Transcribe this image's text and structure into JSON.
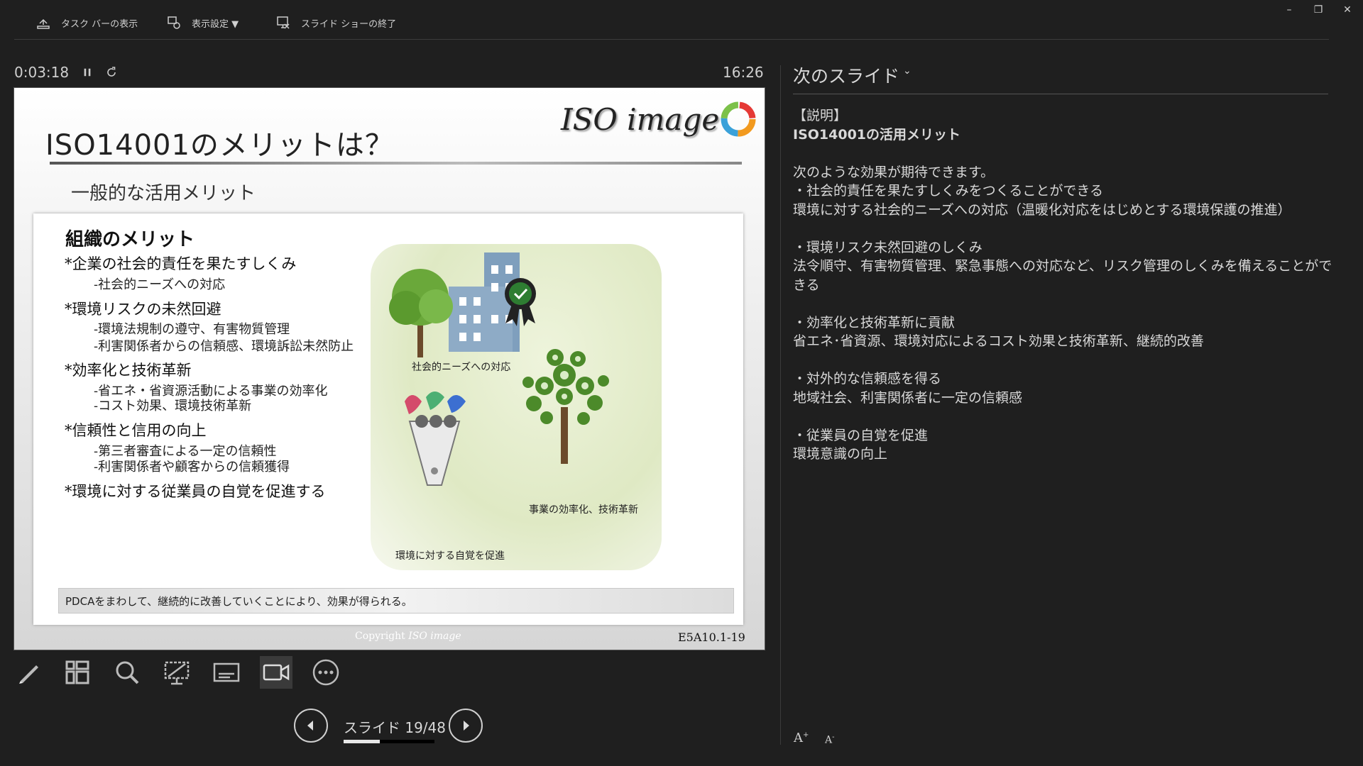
{
  "toolbar": {
    "taskbar_label": "タスク バーの表示",
    "display_label": "表示設定 ▼",
    "end_label": "スライド ショーの終了"
  },
  "window": {
    "minimize": "–",
    "restore": "❐",
    "close": "✕"
  },
  "presenter": {
    "elapsed": "0:03:18",
    "clock": "16:26",
    "pause_icon": "pause-icon",
    "restart_icon": "restart-icon"
  },
  "slide": {
    "title": "ISO14001のメリットは？",
    "subtitle": "一般的な活用メリット",
    "logo_text": "ISO image",
    "section_heading": "組織のメリット",
    "items": [
      {
        "label": "*企業の社会的責任を果たすしくみ",
        "subs": [
          "-社会的ニーズへの対応"
        ]
      },
      {
        "label": "*環境リスクの未然回避",
        "subs": [
          "-環境法規制の遵守、有害物質管理",
          "-利害関係者からの信頼感、環境訴訟未然防止"
        ]
      },
      {
        "label": "*効率化と技術革新",
        "subs": [
          "-省エネ・省資源活動による事業の効率化",
          "-コスト効果、環境技術革新"
        ]
      },
      {
        "label": "*信頼性と信用の向上",
        "subs": [
          "-第三者審査による一定の信頼性",
          "-利害関係者や顧客からの信頼獲得"
        ]
      },
      {
        "label": "*環境に対する従業員の自覚を促進する",
        "subs": []
      }
    ],
    "captions": {
      "social": "社会的ニーズへの対応",
      "efficiency": "事業の効率化、技術革新",
      "awareness": "環境に対する自覚を促進"
    },
    "footer_bar": "PDCAをまわして、継続的に改善していくことにより、効果が得られる。",
    "copyright": "Copyright",
    "copyright_brand": "ISO image",
    "code": "E5A10.1-19"
  },
  "tools": [
    "pen-icon",
    "all-slides-icon",
    "zoom-icon",
    "laser-pointer-icon",
    "subtitles-icon",
    "camera-icon",
    "more-options-icon"
  ],
  "navigation": {
    "slide_counter": "スライド 19/48",
    "current": 19,
    "total": 48
  },
  "notes_panel": {
    "header": "次のスライド",
    "chevron": "⌄",
    "lines": [
      {
        "text": "【説明】",
        "bold": false
      },
      {
        "text": "ISO14001の活用メリット",
        "bold": true
      },
      {
        "text": " ",
        "bold": false
      },
      {
        "text": "次のような効果が期待できます。",
        "bold": false
      },
      {
        "text": "・社会的責任を果たすしくみをつくることができる",
        "bold": false
      },
      {
        "text": "環境に対する社会的ニーズへの対応（温暖化対応をはじめとする環境保護の推進）",
        "bold": false
      },
      {
        "text": " ",
        "bold": false
      },
      {
        "text": "・環境リスク未然回避のしくみ",
        "bold": false
      },
      {
        "text": "法令順守、有害物質管理、緊急事態への対応など、リスク管理のしくみを備えることができる",
        "bold": false
      },
      {
        "text": " ",
        "bold": false
      },
      {
        "text": "・効率化と技術革新に貢献",
        "bold": false
      },
      {
        "text": "省エネ･省資源、環境対応によるコスト効果と技術革新、継続的改善",
        "bold": false
      },
      {
        "text": " ",
        "bold": false
      },
      {
        "text": "・対外的な信頼感を得る",
        "bold": false
      },
      {
        "text": "地域社会、利害関係者に一定の信頼感",
        "bold": false
      },
      {
        "text": " ",
        "bold": false
      },
      {
        "text": "・従業員の自覚を促進",
        "bold": false
      },
      {
        "text": "環境意識の向上",
        "bold": false
      }
    ],
    "font_increase": "A",
    "font_decrease": "A"
  }
}
